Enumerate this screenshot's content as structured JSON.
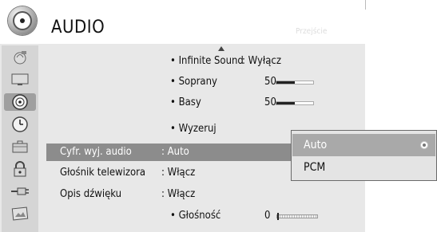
{
  "header": {
    "title": "AUDIO",
    "faded_label": "Przejście"
  },
  "sidebar": {
    "items": [
      {
        "icon": "picture-icon"
      },
      {
        "icon": "monitor-icon"
      },
      {
        "icon": "audio-icon",
        "active": true
      },
      {
        "icon": "clock-icon"
      },
      {
        "icon": "briefcase-icon"
      },
      {
        "icon": "lock-icon"
      },
      {
        "icon": "input-icon"
      },
      {
        "icon": "photo-icon"
      }
    ]
  },
  "menu": {
    "infinite_sound": {
      "label": "• Infinite Sound",
      "value": ": Wyłącz"
    },
    "soprany": {
      "label": "• Soprany",
      "value": "50",
      "level": 50
    },
    "basy": {
      "label": "• Basy",
      "value": "50",
      "level": 50
    },
    "wyzeruj": {
      "label": "• Wyzeruj"
    },
    "cyfr_wyj": {
      "label": "Cyfr. wyj. audio",
      "value": ": Auto"
    },
    "glosnik": {
      "label": "Głośnik telewizora",
      "value": ": Włącz"
    },
    "opis": {
      "label": "Opis dźwięku",
      "value": ": Włącz"
    },
    "glosnosc": {
      "label": "• Głośność",
      "value": "0",
      "level": 0
    }
  },
  "popup": {
    "options": [
      {
        "label": "Auto",
        "selected": true
      },
      {
        "label": "PCM",
        "selected": false
      }
    ]
  }
}
